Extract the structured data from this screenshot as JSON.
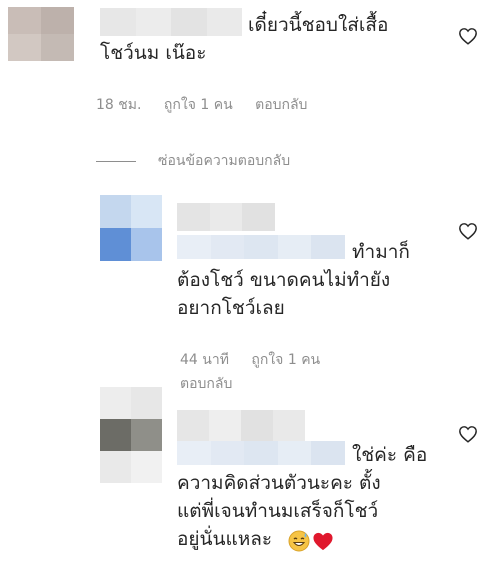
{
  "colors": {
    "text": "#262626",
    "meta": "#8e8e8e",
    "heart_red": "#ed4956",
    "emoji_yellow": "#f6c445"
  },
  "comment_1": {
    "text": "เดี๋ยวนี้ชอบใส่เสื้อ\nโชว์นม เน๊อะ",
    "time": "18 ชม.",
    "likes": "ถูกใจ 1 คน",
    "reply": "ตอบกลับ",
    "icon": "heart-outline-icon"
  },
  "hide_replies": {
    "label": "ซ่อนข้อความตอบกลับ"
  },
  "reply_1": {
    "text_first": "ทำมาก็",
    "text_rest": "ต้องโชว์ ขนาดคนไม่ทำยัง\nอยากโชว์เลย",
    "time": "44 นาที",
    "likes": "ถูกใจ 1 คน",
    "reply": "ตอบกลับ",
    "icon": "heart-outline-icon"
  },
  "reply_2": {
    "text_first": "ใช่ค่ะ คือ",
    "text_rest": "ความคิดส่วนตัวนะคะ ตั้ง\nแต่พี่เจนทำนมเสร็จก็โชว์\nอยู่นั่นแหละ",
    "emojis": [
      "sweat-smile-emoji",
      "red-heart-emoji"
    ],
    "icon": "heart-outline-icon"
  }
}
